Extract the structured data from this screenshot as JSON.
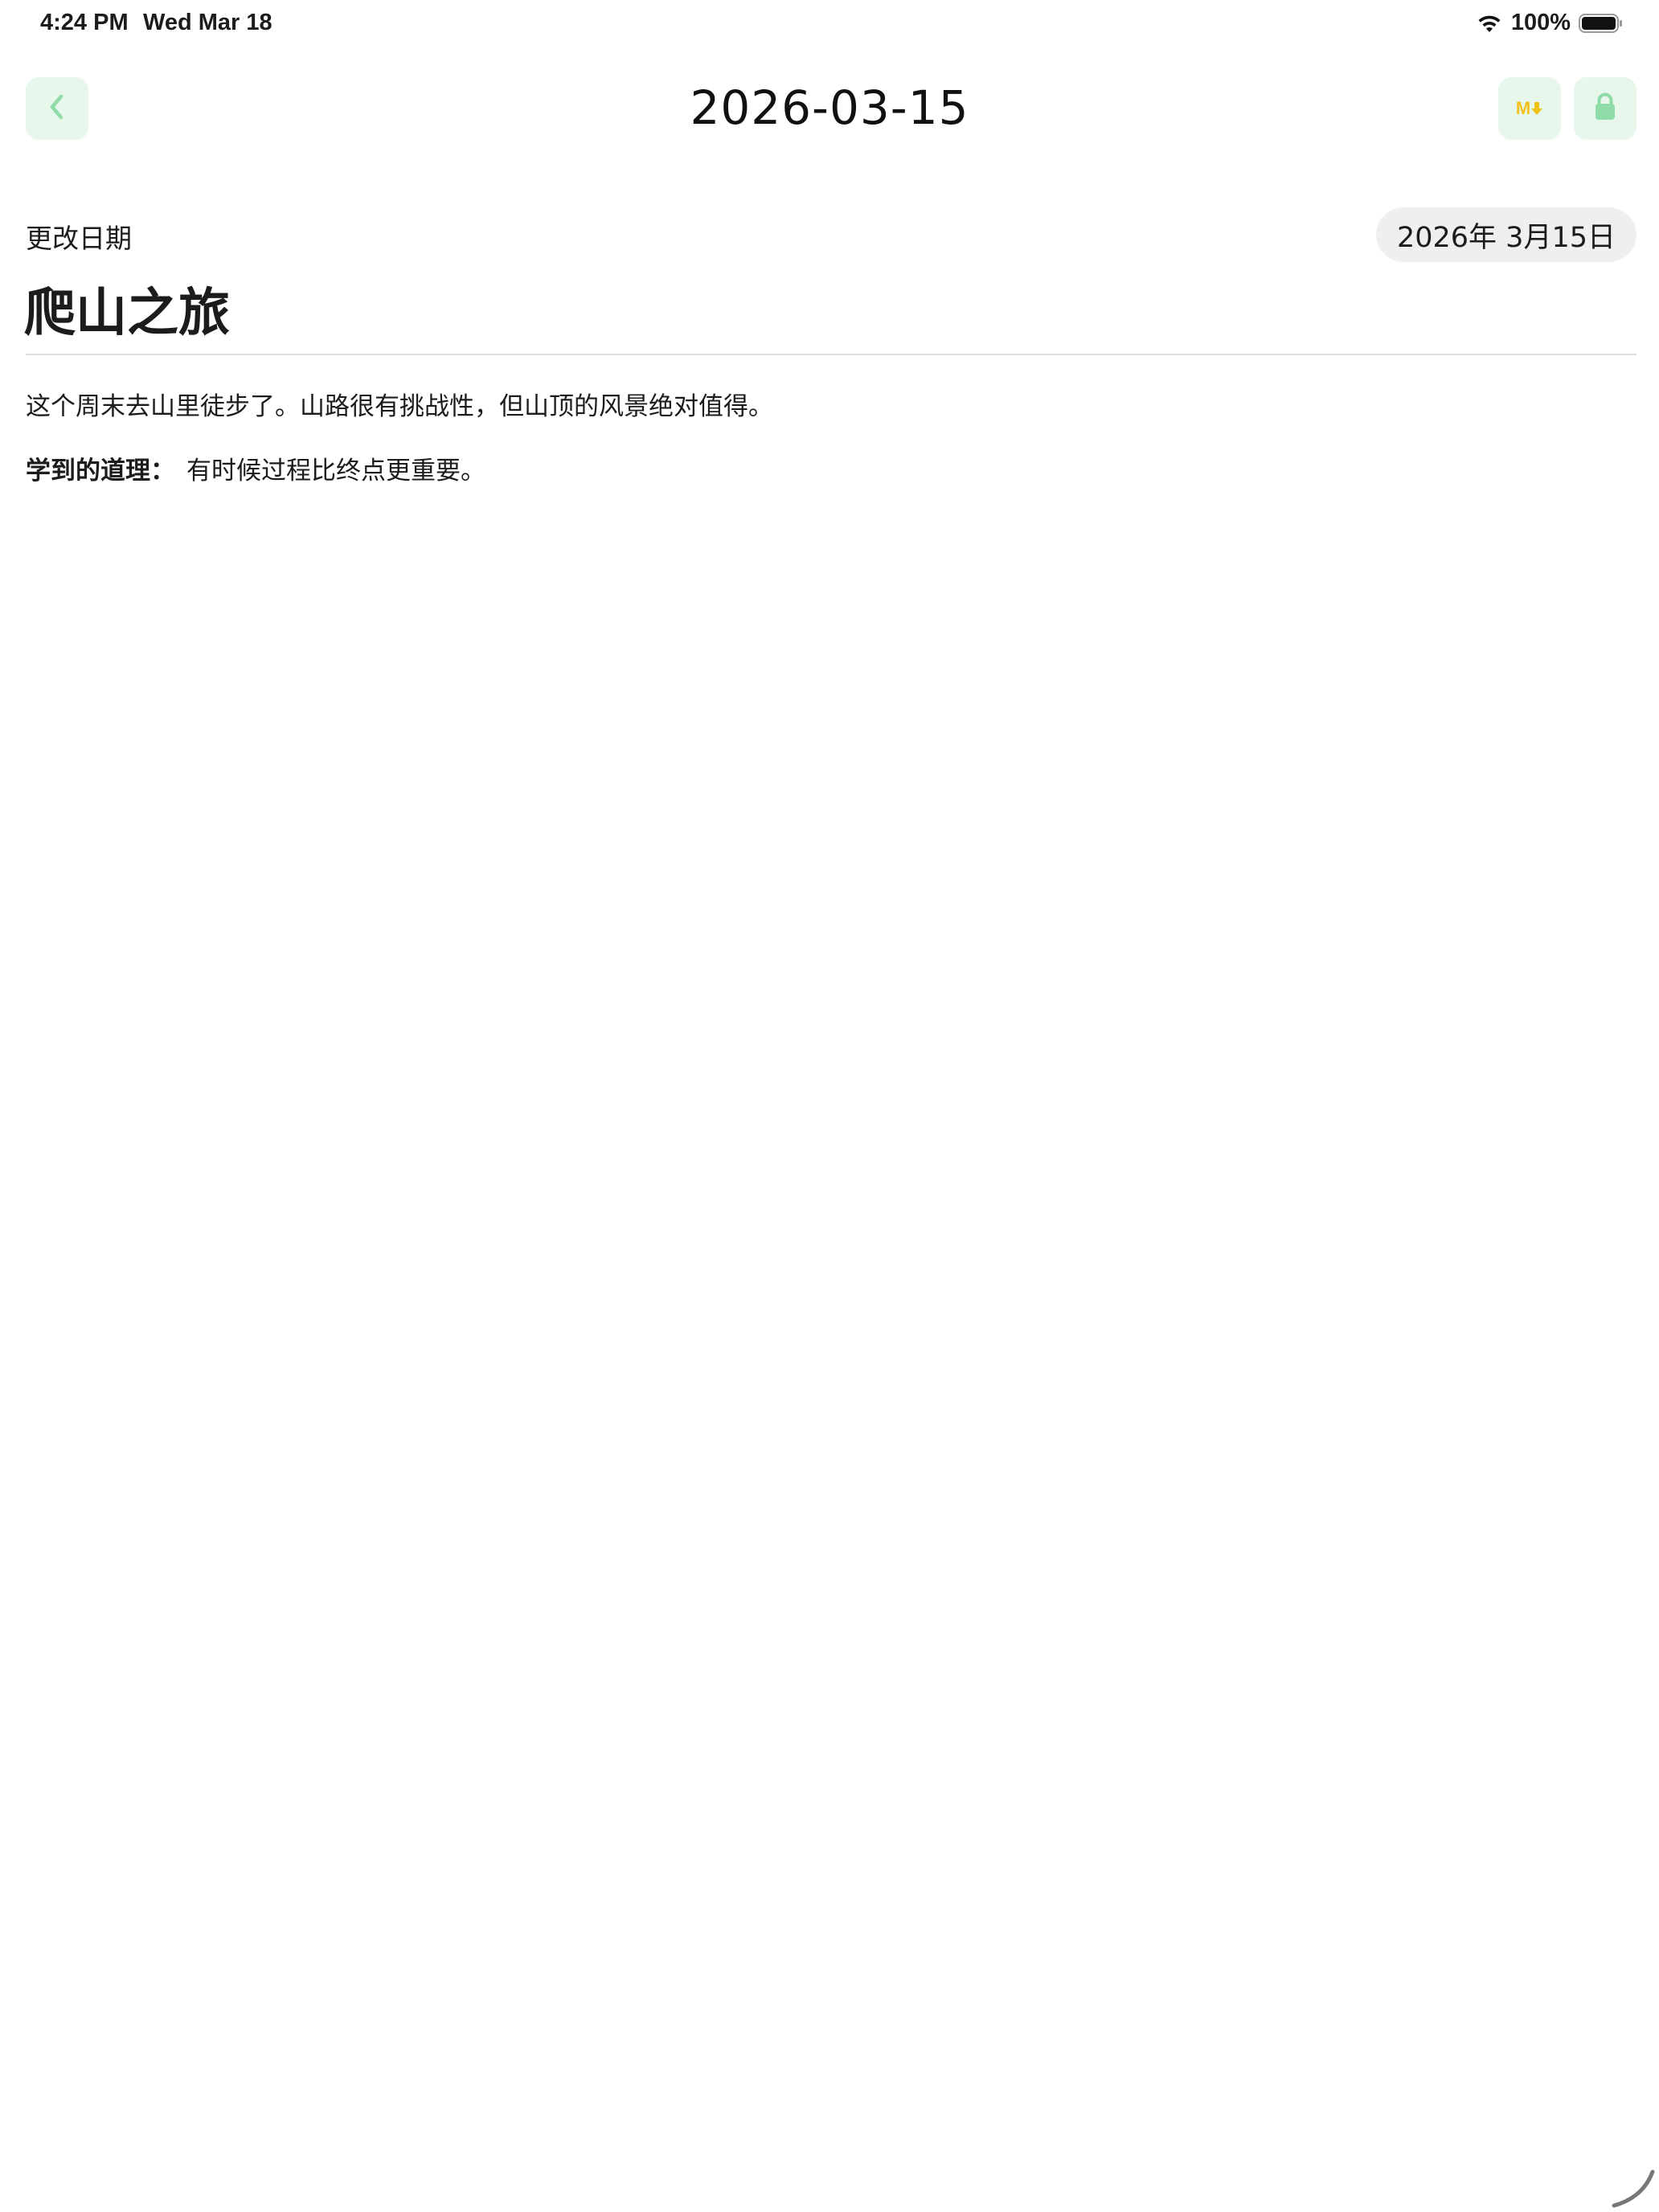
{
  "status_bar": {
    "time": "4:24 PM",
    "date": "Wed Mar 18",
    "battery_percent": "100%",
    "icons": [
      "wifi-icon",
      "battery-icon"
    ]
  },
  "nav": {
    "title": "2026-03-15",
    "back_icon": "chevron-left-icon",
    "markdown_label": "M",
    "markdown_icon": "markdown-icon",
    "lock_icon": "lock-icon",
    "accent_color": "#8fdca8",
    "button_bg": "#e8f7ec",
    "markdown_color": "#f2c118"
  },
  "entry": {
    "date_label": "更改日期",
    "date_value": "2026年 3月15日",
    "title": "爬山之旅",
    "paragraph": "这个周末去山里徒步了。山路很有挑战性，但山顶的风景绝对值得。",
    "lesson_label": "学到的道理：",
    "lesson_text": "有时候过程比终点更重要。"
  }
}
